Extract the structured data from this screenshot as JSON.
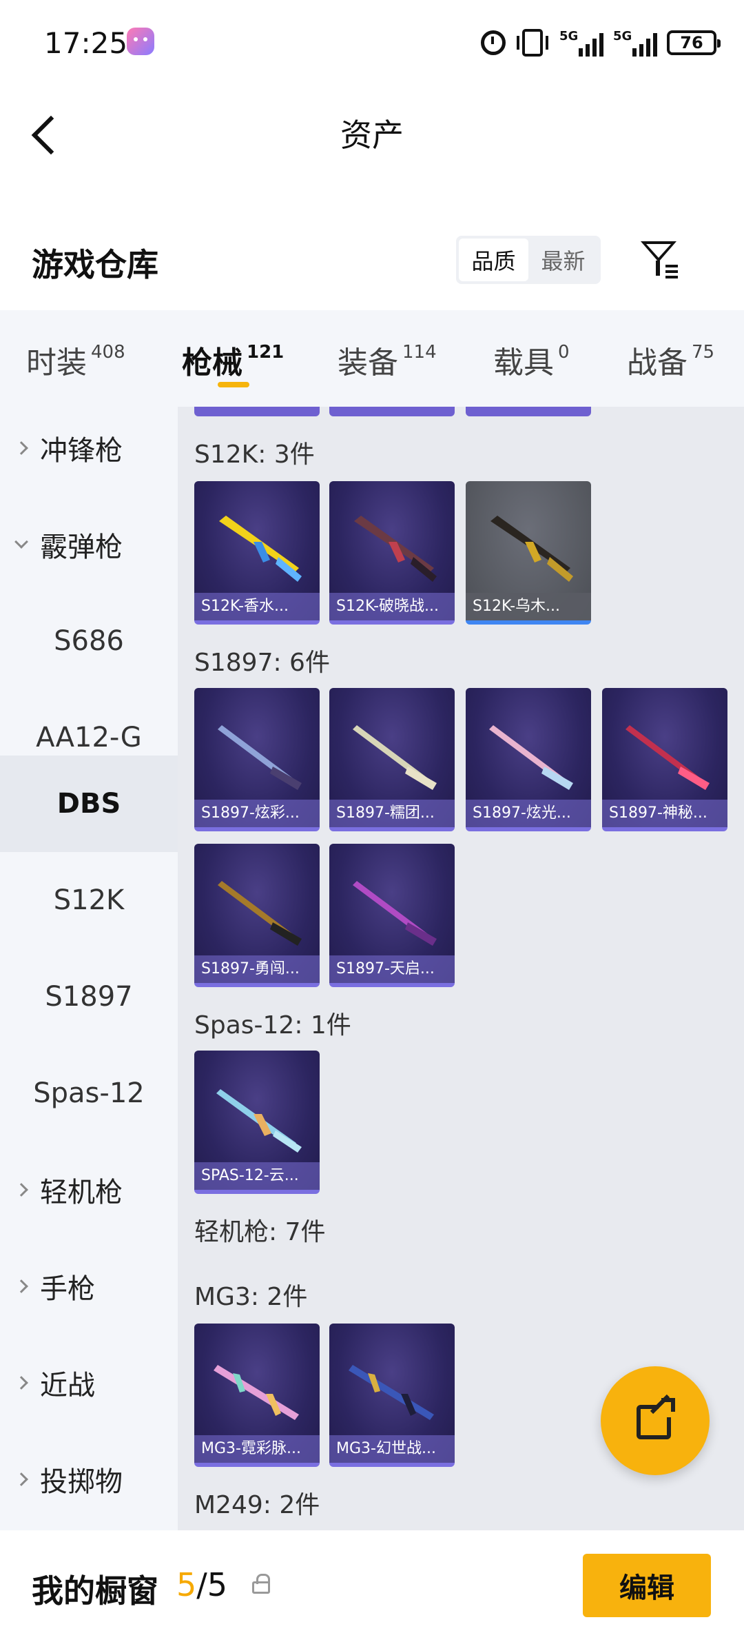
{
  "status": {
    "time": "17:25",
    "battery": "76",
    "net1": "5G",
    "net2": "5G"
  },
  "header": {
    "title": "资产"
  },
  "warehouse": {
    "title": "游戏仓库",
    "sort_quality": "品质",
    "sort_latest": "最新"
  },
  "tabs": [
    {
      "label": "时装",
      "count": "408"
    },
    {
      "label": "枪械",
      "count": "121"
    },
    {
      "label": "装备",
      "count": "114"
    },
    {
      "label": "载具",
      "count": "0"
    },
    {
      "label": "战备",
      "count": "75"
    }
  ],
  "sidebar": {
    "items": [
      {
        "label": "冲锋枪"
      },
      {
        "label": "霰弹枪"
      },
      {
        "label": "S686"
      },
      {
        "label": "AA12-G"
      },
      {
        "label": "DBS"
      },
      {
        "label": "S12K"
      },
      {
        "label": "S1897"
      },
      {
        "label": "Spas-12"
      },
      {
        "label": "轻机枪"
      },
      {
        "label": "手枪"
      },
      {
        "label": "近战"
      },
      {
        "label": "投掷物"
      }
    ]
  },
  "sections": {
    "s12k": {
      "title": "S12K: 3件",
      "items": [
        "S12K-香水...",
        "S12K-破晓战...",
        "S12K-乌木..."
      ]
    },
    "s1897": {
      "title": "S1897: 6件",
      "items": [
        "S1897-炫彩...",
        "S1897-糯团...",
        "S1897-炫光...",
        "S1897-神秘...",
        "S1897-勇闯...",
        "S1897-天启..."
      ]
    },
    "spas": {
      "title": "Spas-12: 1件",
      "items": [
        "SPAS-12-云..."
      ]
    },
    "lmg": {
      "title": "轻机枪: 7件"
    },
    "mg3": {
      "title": "MG3: 2件",
      "items": [
        "MG3-霓彩脉...",
        "MG3-幻世战..."
      ]
    },
    "m249": {
      "title": "M249: 2件"
    }
  },
  "bottom": {
    "showcase_label": "我的橱窗",
    "count_current": "5",
    "count_total": "/5",
    "edit_label": "编辑"
  },
  "colors": {
    "accent": "#f8b20d",
    "card_bg": "#2c2560",
    "card_border": "#7a6fe0"
  }
}
